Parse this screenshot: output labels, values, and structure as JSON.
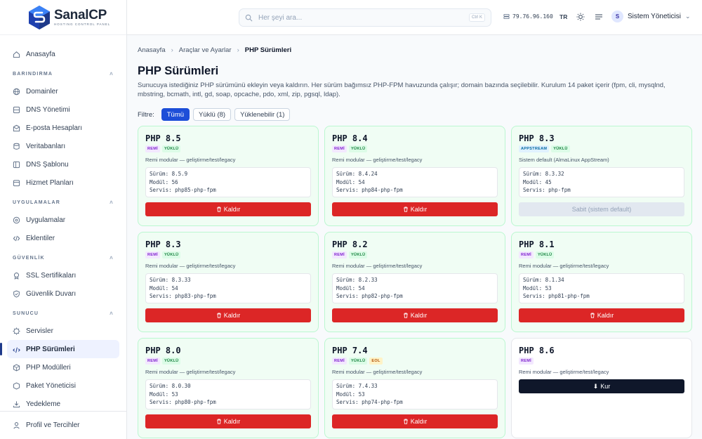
{
  "brand": {
    "name": "SanalCP",
    "tagline": "HOSTING CONTROL PANEL"
  },
  "sidebar": {
    "top": [
      {
        "label": "Anasayfa",
        "icon": "home-icon"
      }
    ],
    "sections": [
      {
        "title": "BARINDIRMA",
        "items": [
          {
            "label": "Domainler",
            "icon": "globe-icon"
          },
          {
            "label": "DNS Yönetimi",
            "icon": "dns-icon"
          },
          {
            "label": "E-posta Hesapları",
            "icon": "mail-icon"
          },
          {
            "label": "Veritabanları",
            "icon": "database-icon"
          },
          {
            "label": "DNS Şablonu",
            "icon": "template-icon"
          },
          {
            "label": "Hizmet Planları",
            "icon": "plan-icon"
          }
        ]
      },
      {
        "title": "UYGULAMALAR",
        "items": [
          {
            "label": "Uygulamalar",
            "icon": "apps-icon"
          },
          {
            "label": "Eklentiler",
            "icon": "code-icon"
          }
        ]
      },
      {
        "title": "GÜVENLİK",
        "items": [
          {
            "label": "SSL Sertifikaları",
            "icon": "certificate-icon"
          },
          {
            "label": "Güvenlik Duvarı",
            "icon": "shield-icon"
          }
        ]
      },
      {
        "title": "SUNUCU",
        "items": [
          {
            "label": "Servisler",
            "icon": "services-icon"
          },
          {
            "label": "PHP Sürümleri",
            "icon": "php-icon",
            "active": true
          },
          {
            "label": "PHP Modülleri",
            "icon": "module-icon"
          },
          {
            "label": "Paket Yöneticisi",
            "icon": "package-icon"
          },
          {
            "label": "Yedekleme",
            "icon": "backup-icon"
          }
        ]
      }
    ],
    "footer": {
      "label": "Profil ve Tercihler",
      "icon": "user-icon"
    }
  },
  "header": {
    "search_placeholder": "Her şeyi ara...",
    "shortcut": "Ctrl K",
    "ip": "79.76.96.160",
    "lang": "TR",
    "user_initial": "S",
    "user_name": "Sistem Yöneticisi"
  },
  "breadcrumb": [
    "Anasayfa",
    "Araçlar ve Ayarlar",
    "PHP Sürümleri"
  ],
  "page": {
    "title": "PHP Sürümleri",
    "description": "Sunucuya istediğiniz PHP sürümünü ekleyin veya kaldırın. Her sürüm bağımsız PHP-FPM havuzunda çalışır; domain bazında seçilebilir. Kurulum 14 paket içerir (fpm, cli, mysqlnd, mbstring, bcmath, intl, gd, soap, opcache, pdo, xml, zip, pgsql, ldap)."
  },
  "filter": {
    "label": "Filtre:",
    "options": [
      "Tümü",
      "Yüklü (8)",
      "Yüklenebilir (1)"
    ],
    "selected": "Tümü"
  },
  "labels": {
    "version": "Sürüm:",
    "modules": "Modül:",
    "service": "Servis:",
    "remove": "Kaldır",
    "install": "Kur",
    "fixed": "Sabit (sistem default)"
  },
  "versions": [
    {
      "name": "PHP 8.5",
      "badges": [
        "REMİ",
        "YÜKLÜ"
      ],
      "source": "Remi modular — geliştirme/test/legacy",
      "version": "8.5.9",
      "modules": "56",
      "service": "php85-php-fpm",
      "action": "remove",
      "installed": true
    },
    {
      "name": "PHP 8.4",
      "badges": [
        "REMİ",
        "YÜKLÜ"
      ],
      "source": "Remi modular — geliştirme/test/legacy",
      "version": "8.4.24",
      "modules": "54",
      "service": "php84-php-fpm",
      "action": "remove",
      "installed": true
    },
    {
      "name": "PHP 8.3",
      "badges": [
        "APPSTREAM",
        "YÜKLÜ"
      ],
      "source": "Sistem default (AlmaLinux AppStream)",
      "version": "8.3.32",
      "modules": "45",
      "service": "php-fpm",
      "action": "fixed",
      "installed": true
    },
    {
      "name": "PHP 8.3",
      "badges": [
        "REMİ",
        "YÜKLÜ"
      ],
      "source": "Remi modular — geliştirme/test/legacy",
      "version": "8.3.33",
      "modules": "54",
      "service": "php83-php-fpm",
      "action": "remove",
      "installed": true
    },
    {
      "name": "PHP 8.2",
      "badges": [
        "REMİ",
        "YÜKLÜ"
      ],
      "source": "Remi modular — geliştirme/test/legacy",
      "version": "8.2.33",
      "modules": "54",
      "service": "php82-php-fpm",
      "action": "remove",
      "installed": true
    },
    {
      "name": "PHP 8.1",
      "badges": [
        "REMİ",
        "YÜKLÜ"
      ],
      "source": "Remi modular — geliştirme/test/legacy",
      "version": "8.1.34",
      "modules": "53",
      "service": "php81-php-fpm",
      "action": "remove",
      "installed": true
    },
    {
      "name": "PHP 8.0",
      "badges": [
        "REMİ",
        "YÜKLÜ"
      ],
      "source": "Remi modular — geliştirme/test/legacy",
      "version": "8.0.30",
      "modules": "53",
      "service": "php80-php-fpm",
      "action": "remove",
      "installed": true
    },
    {
      "name": "PHP 7.4",
      "badges": [
        "REMİ",
        "YÜKLÜ",
        "EOL"
      ],
      "source": "Remi modular — geliştirme/test/legacy",
      "version": "7.4.33",
      "modules": "53",
      "service": "php74-php-fpm",
      "action": "remove",
      "installed": true
    },
    {
      "name": "PHP 8.6",
      "badges": [
        "REMİ"
      ],
      "source": "Remi modular — geliştirme/test/legacy",
      "action": "install",
      "installed": false
    }
  ],
  "colors": {
    "accent": "#1d4ed8",
    "danger": "#dc2626",
    "installed_bg": "#f0fdf4",
    "installed_border": "#bbf7d0",
    "dark_button": "#0f172a"
  }
}
